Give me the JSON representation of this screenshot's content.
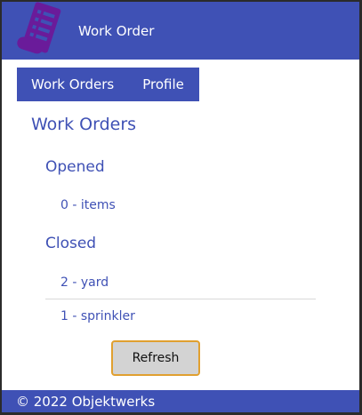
{
  "header": {
    "title": "Work Order",
    "logo_icon": "document-list-icon"
  },
  "nav": {
    "items": [
      {
        "label": "Work Orders"
      },
      {
        "label": "Profile"
      }
    ]
  },
  "page": {
    "title": "Work Orders"
  },
  "opened": {
    "title": "Opened",
    "items": [
      {
        "label": "0 - items"
      }
    ]
  },
  "closed": {
    "title": "Closed",
    "items": [
      {
        "label": "2 - yard"
      },
      {
        "label": "1 - sprinkler"
      }
    ]
  },
  "actions": {
    "refresh_label": "Refresh"
  },
  "footer": {
    "text": "© 2022 Objektwerks"
  },
  "colors": {
    "primary": "#3f51b5",
    "logo": "#6a1b9a",
    "button_border": "#e0a030"
  }
}
